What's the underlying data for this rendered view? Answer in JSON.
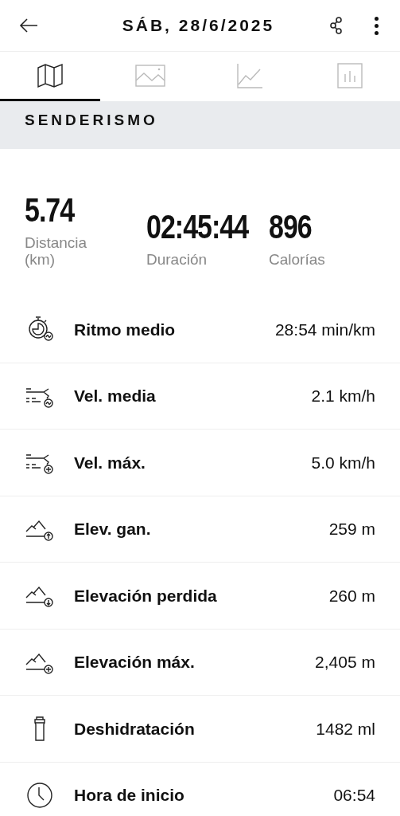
{
  "header": {
    "title": "SÁB, 28/6/2025"
  },
  "tabs": [
    {
      "kind": "map",
      "selected": true
    },
    {
      "kind": "photo",
      "selected": false
    },
    {
      "kind": "graph",
      "selected": false
    },
    {
      "kind": "bars",
      "selected": false
    }
  ],
  "activity": "SENDERISMO",
  "summary": [
    {
      "value": "5.74",
      "label": "Distancia\n(km)"
    },
    {
      "value": "02:45:44",
      "label": "Duración"
    },
    {
      "value": "896",
      "label": "Calorías"
    }
  ],
  "metrics": [
    {
      "kind": "pace",
      "label": "Ritmo medio",
      "value": "28:54 min/km"
    },
    {
      "kind": "speed-avg",
      "label": "Vel. media",
      "value": "2.1 km/h"
    },
    {
      "kind": "speed-max",
      "label": "Vel. máx.",
      "value": "5.0 km/h"
    },
    {
      "kind": "elev-up",
      "label": "Elev. gan.",
      "value": "259 m"
    },
    {
      "kind": "elev-down",
      "label": "Elevación perdida",
      "value": "260 m"
    },
    {
      "kind": "elev-max",
      "label": "Elevación máx.",
      "value": "2,405 m"
    },
    {
      "kind": "bottle",
      "label": "Deshidratación",
      "value": "1482 ml"
    },
    {
      "kind": "clock",
      "label": "Hora de inicio",
      "value": "06:54"
    }
  ]
}
